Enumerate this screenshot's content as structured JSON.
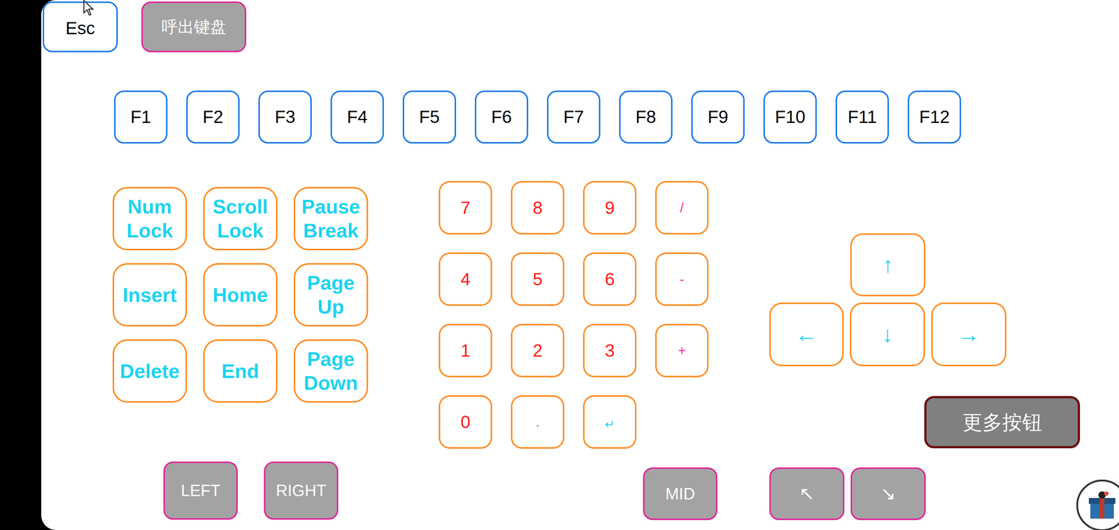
{
  "top_buttons": [
    {
      "label": "Esc",
      "kind": "key"
    },
    {
      "label": "呼出键盘",
      "kind": "action"
    }
  ],
  "function_keys": [
    "F1",
    "F2",
    "F3",
    "F4",
    "F5",
    "F6",
    "F7",
    "F8",
    "F9",
    "F10",
    "F11",
    "F12"
  ],
  "navigation_keys": [
    "Num Lock",
    "Scroll Lock",
    "Pause Break",
    "Insert",
    "Home",
    "Page Up",
    "Delete",
    "End",
    "Page Down"
  ],
  "numpad": [
    {
      "label": "7",
      "kind": "digit"
    },
    {
      "label": "8",
      "kind": "digit"
    },
    {
      "label": "9",
      "kind": "digit"
    },
    {
      "label": "/",
      "kind": "operator"
    },
    {
      "label": "4",
      "kind": "digit"
    },
    {
      "label": "5",
      "kind": "digit"
    },
    {
      "label": "6",
      "kind": "digit"
    },
    {
      "label": "-",
      "kind": "operator"
    },
    {
      "label": "1",
      "kind": "digit"
    },
    {
      "label": "2",
      "kind": "digit"
    },
    {
      "label": "3",
      "kind": "digit"
    },
    {
      "label": "+",
      "kind": "operator"
    },
    {
      "label": "0",
      "kind": "digit"
    },
    {
      "label": ".",
      "kind": "operator"
    },
    {
      "label": "↵",
      "kind": "enter"
    }
  ],
  "arrow_keys": {
    "up": "↑",
    "left": "←",
    "down": "↓",
    "right": "→"
  },
  "more_button": "更多按钮",
  "mouse_buttons": [
    "LEFT",
    "RIGHT"
  ],
  "middle_button": "MID",
  "scroll_buttons": [
    "↖",
    "↘"
  ]
}
